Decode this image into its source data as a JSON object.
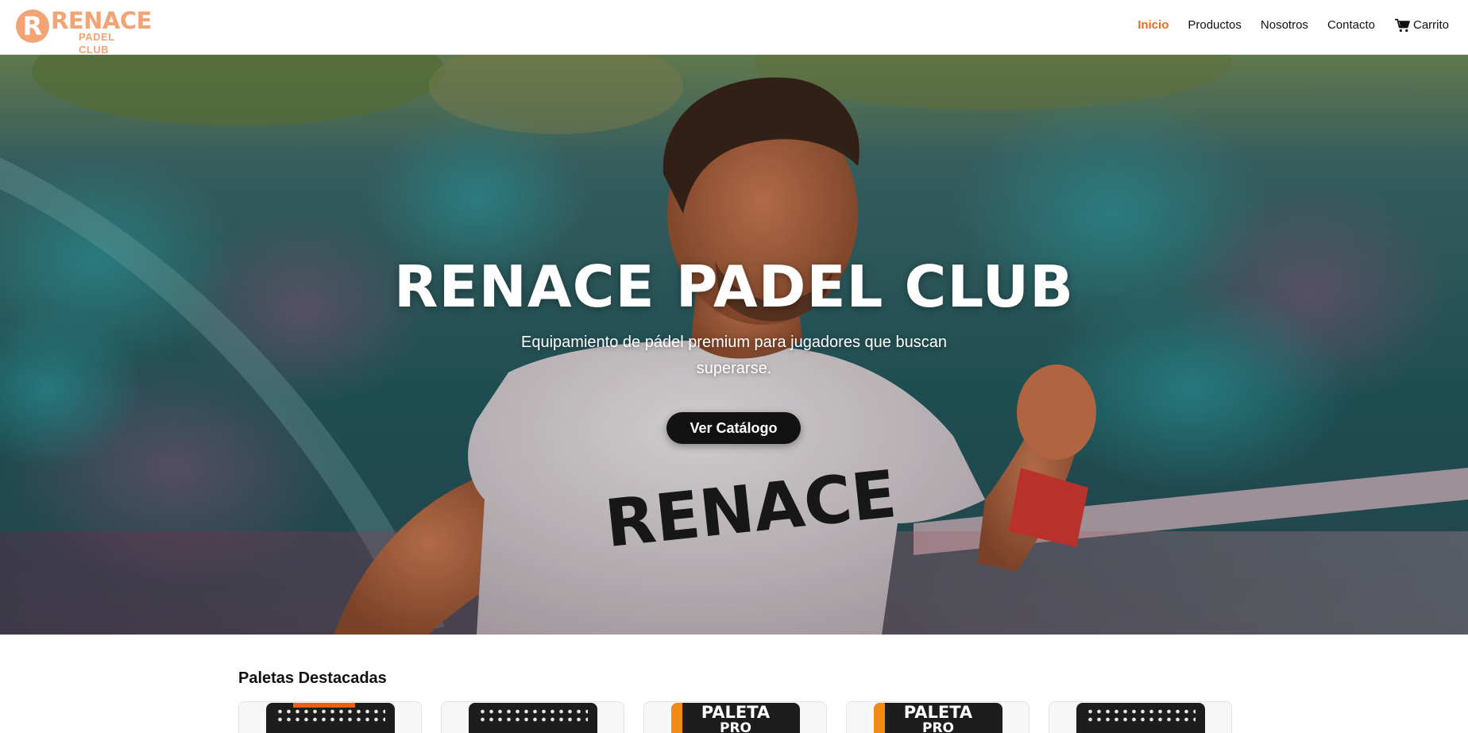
{
  "brand": {
    "logo_initial": "R",
    "logo_word": "RENACE",
    "logo_sub": "PADEL CLUB",
    "accent_color": "#f2a474"
  },
  "nav": {
    "items": [
      {
        "label": "Inicio",
        "active": true
      },
      {
        "label": "Productos"
      },
      {
        "label": "Nosotros"
      },
      {
        "label": "Contacto"
      }
    ],
    "cart_label": "Carrito",
    "active_color": "#f26a1b"
  },
  "hero": {
    "title": "RENACE PADEL CLUB",
    "subtitle": "Equipamiento de pádel premium para jugadores que buscan superarse.",
    "cta_label": "Ver Catálogo",
    "shirt_text": "RENACE"
  },
  "featured": {
    "title": "Paletas Destacadas",
    "cards": [
      {
        "icon": "paddle-image",
        "label": ""
      },
      {
        "icon": "paddle-image",
        "label": ""
      },
      {
        "icon": "paddle-image",
        "label": "PALETA",
        "label2": "PRO"
      },
      {
        "icon": "paddle-image",
        "label": "PALETA",
        "label2": "PRO"
      },
      {
        "icon": "paddle-image",
        "label": ""
      }
    ]
  }
}
